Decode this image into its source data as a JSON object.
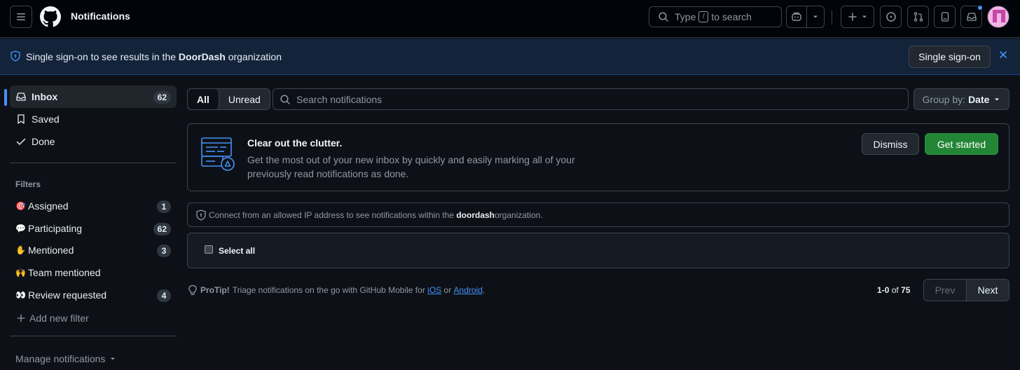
{
  "header": {
    "title": "Notifications",
    "search": {
      "prefix": "Type",
      "key": "/",
      "suffix": "to search"
    }
  },
  "banner": {
    "text_before": "Single sign-on to see results in the ",
    "org": "DoorDash",
    "text_after": " organization",
    "button": "Single sign-on"
  },
  "sidebar": {
    "items": [
      {
        "label": "Inbox",
        "count": "62"
      },
      {
        "label": "Saved"
      },
      {
        "label": "Done"
      }
    ],
    "filters_heading": "Filters",
    "filters": [
      {
        "emoji": "🎯",
        "label": "Assigned",
        "count": "1"
      },
      {
        "emoji": "💬",
        "label": "Participating",
        "count": "62"
      },
      {
        "emoji": "✋",
        "label": "Mentioned",
        "count": "3"
      },
      {
        "emoji": "🙌",
        "label": "Team mentioned",
        "count": ""
      },
      {
        "emoji": "👀",
        "label": "Review requested",
        "count": "4"
      }
    ],
    "add_filter": "Add new filter",
    "manage": "Manage notifications"
  },
  "main": {
    "tabs": [
      "All",
      "Unread"
    ],
    "search_placeholder": "Search notifications",
    "group_by_label": "Group by:",
    "group_by_value": "Date",
    "clutter_card": {
      "title": "Clear out the clutter.",
      "description": "Get the most out of your new inbox by quickly and easily marking all of your previously read notifications as done.",
      "dismiss": "Dismiss",
      "get_started": "Get started"
    },
    "ip_notice": {
      "before": "Connect from an allowed IP address to see notifications within the ",
      "org": "doordash",
      "after": " organization."
    },
    "select_all": "Select all",
    "protip": {
      "label": "ProTip!",
      "text": "Triage notifications on the go with GitHub Mobile for",
      "ios": "iOS",
      "or": "or",
      "android": "Android",
      "end": "."
    },
    "pagination": {
      "range": "1-0",
      "of": "of",
      "total": "75",
      "prev": "Prev",
      "next": "Next"
    }
  },
  "colors": {
    "accent": "#4493f8",
    "success": "#238636",
    "background": "#0d1117"
  }
}
